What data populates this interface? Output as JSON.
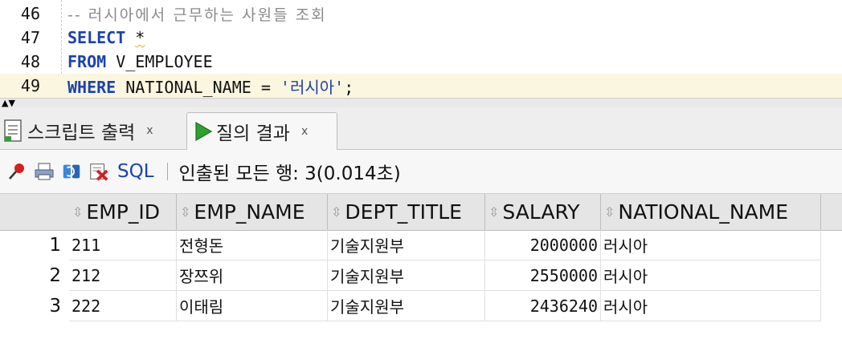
{
  "editor": {
    "lines": [
      {
        "num": "46",
        "comment": "-- 러시아에서 근무하는 사원들 조회"
      },
      {
        "num": "47",
        "kw": "SELECT",
        "rest": "*"
      },
      {
        "num": "48",
        "kw": "FROM",
        "rest": "V_EMPLOYEE"
      },
      {
        "num": "49",
        "kw": "WHERE",
        "rest": "NATIONAL_NAME = ",
        "str": "'러시아'",
        "end": ";"
      }
    ]
  },
  "tabs": [
    {
      "label": "스크립트 출력",
      "close": "x"
    },
    {
      "label": "질의 결과",
      "close": "x"
    }
  ],
  "toolbar": {
    "sql_label": "SQL",
    "status": "인출된 모든 행: 3(0.014초)"
  },
  "grid": {
    "columns": [
      "EMP_ID",
      "EMP_NAME",
      "DEPT_TITLE",
      "SALARY",
      "NATIONAL_NAME"
    ],
    "rows": [
      {
        "n": "1",
        "emp_id": "211",
        "emp_name": "전형돈",
        "dept_title": "기술지원부",
        "salary": "2000000",
        "national_name": "러시아"
      },
      {
        "n": "2",
        "emp_id": "212",
        "emp_name": "장쯔위",
        "dept_title": "기술지원부",
        "salary": "2550000",
        "national_name": "러시아"
      },
      {
        "n": "3",
        "emp_id": "222",
        "emp_name": "이태림",
        "dept_title": "기술지원부",
        "salary": "2436240",
        "national_name": "러시아"
      }
    ]
  },
  "colors": {
    "keyword": "#1b41b3",
    "comment": "#8a8a8a",
    "current_line": "#fbf6df",
    "play_green": "#2ea12e"
  },
  "icons": [
    "pin-icon",
    "print-icon",
    "refresh-icon",
    "delete-icon",
    "script-icon",
    "run-icon",
    "splitter-arrows-icon",
    "sort-icon"
  ]
}
